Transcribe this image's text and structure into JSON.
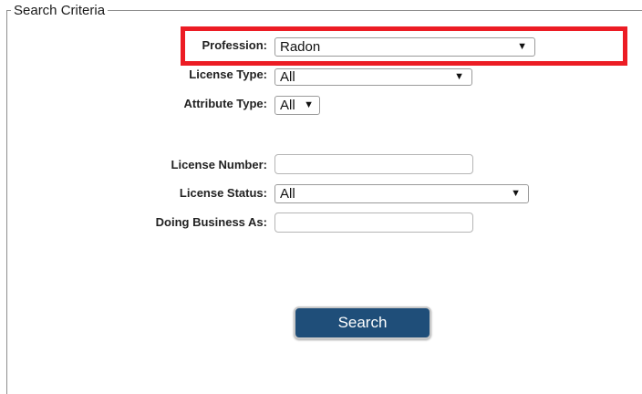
{
  "fieldset": {
    "legend": "Search Criteria"
  },
  "form": {
    "profession": {
      "label": "Profession:",
      "value": "Radon"
    },
    "license_type": {
      "label": "License Type:",
      "value": "All"
    },
    "attribute_type": {
      "label": "Attribute Type:",
      "value": "All"
    },
    "license_number": {
      "label": "License Number:",
      "value": ""
    },
    "license_status": {
      "label": "License Status:",
      "value": "All"
    },
    "doing_business_as": {
      "label": "Doing Business As:",
      "value": ""
    }
  },
  "buttons": {
    "search_label": "Search"
  },
  "icons": {
    "dropdown": "caret-down-icon"
  },
  "colors": {
    "highlight": "#ec1c24",
    "button_bg": "#1f4e79",
    "button_text": "#ffffff"
  }
}
